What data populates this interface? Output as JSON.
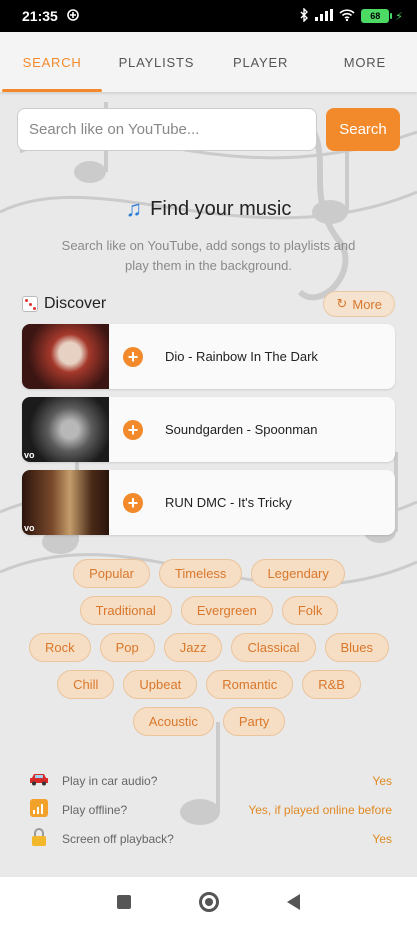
{
  "status_bar": {
    "time": "21:35",
    "battery": "68"
  },
  "tabs": [
    {
      "label": "SEARCH",
      "active": true
    },
    {
      "label": "PLAYLISTS",
      "active": false
    },
    {
      "label": "PLAYER",
      "active": false
    },
    {
      "label": "MORE",
      "active": false
    }
  ],
  "search": {
    "placeholder": "Search like on YouTube...",
    "button_label": "Search"
  },
  "hero": {
    "icon": "music-note-icon",
    "title": "Find your music",
    "subtitle": "Search like on YouTube, add songs to playlists and play them in the background."
  },
  "discover": {
    "title": "Discover",
    "more_label": "More",
    "songs": [
      {
        "title": "Dio - Rainbow In The Dark",
        "thumb_colors": [
          "#3a1512",
          "#a4382b",
          "#e7d1c2"
        ]
      },
      {
        "title": "Soundgarden - Spoonman",
        "thumb_colors": [
          "#1b1b1b",
          "#5b5b5b",
          "#b8b8b8"
        ]
      },
      {
        "title": "RUN DMC - It's Tricky",
        "thumb_colors": [
          "#2b140c",
          "#7a4a2c",
          "#c49d6b"
        ]
      }
    ]
  },
  "genres": [
    [
      "Popular",
      "Timeless",
      "Legendary"
    ],
    [
      "Traditional",
      "Evergreen",
      "Folk"
    ],
    [
      "Rock",
      "Pop",
      "Jazz",
      "Classical",
      "Blues"
    ],
    [
      "Chill",
      "Upbeat",
      "Romantic",
      "R&B"
    ],
    [
      "Acoustic",
      "Party"
    ]
  ],
  "faq": [
    {
      "icon": "car-icon",
      "question": "Play in car audio?",
      "answer": "Yes"
    },
    {
      "icon": "signal-icon",
      "question": "Play offline?",
      "answer": "Yes, if played online before"
    },
    {
      "icon": "lock-icon",
      "question": "Screen off playback?",
      "answer": "Yes"
    }
  ],
  "colors": {
    "accent": "#f28a2c",
    "chip_bg": "#f6dec5"
  }
}
